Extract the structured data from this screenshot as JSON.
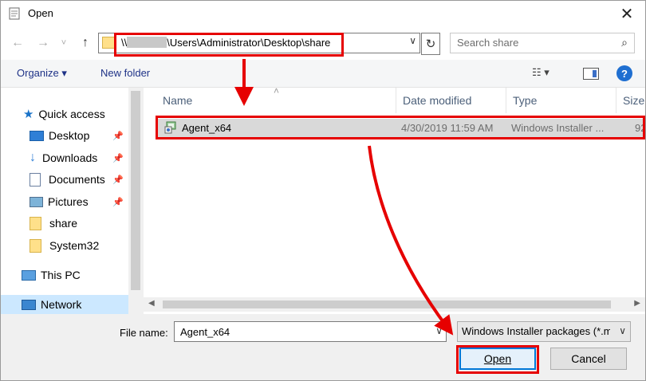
{
  "window": {
    "title": "Open"
  },
  "nav": {
    "back": "←",
    "forward": "→",
    "recent": "˅",
    "up": "↑",
    "address_prefix": "\\\\",
    "address_path": "\\Users\\Administrator\\Desktop\\share",
    "address_chevron": "∨",
    "refresh": "↻",
    "search_placeholder": "Search share",
    "search_icon": "⌕"
  },
  "toolbar": {
    "organize": "Organize ▾",
    "new_folder": "New folder",
    "view_icon": "☷ ▾",
    "help": "?"
  },
  "sidebar": {
    "items": [
      {
        "label": "Quick access",
        "icon": "star-icon",
        "pinned": false
      },
      {
        "label": "Desktop",
        "icon": "desktop-icon",
        "pinned": true
      },
      {
        "label": "Downloads",
        "icon": "download-icon",
        "pinned": true
      },
      {
        "label": "Documents",
        "icon": "document-icon",
        "pinned": true
      },
      {
        "label": "Pictures",
        "icon": "pictures-icon",
        "pinned": true
      },
      {
        "label": "share",
        "icon": "folder-icon",
        "pinned": false
      },
      {
        "label": "System32",
        "icon": "folder-icon",
        "pinned": false
      },
      {
        "label": "This PC",
        "icon": "computer-icon",
        "pinned": false
      },
      {
        "label": "Network",
        "icon": "network-icon",
        "pinned": false
      }
    ],
    "pin_glyph": "📌"
  },
  "files": {
    "columns": [
      "Name",
      "Date modified",
      "Type",
      "Size"
    ],
    "sort_arrow": "˄",
    "rows": [
      {
        "name": "Agent_x64",
        "date": "4/30/2019 11:59 AM",
        "type": "Windows Installer ...",
        "size": "92"
      }
    ]
  },
  "footer": {
    "file_name_label": "File name:",
    "file_name_value": "Agent_x64",
    "file_type": "Windows Installer packages (*.m",
    "open_label": "Open",
    "cancel_label": "Cancel",
    "chevron": "∨"
  },
  "colors": {
    "highlight": "#e60000",
    "selection": "#d9d9d9",
    "accent": "#0078d7"
  }
}
